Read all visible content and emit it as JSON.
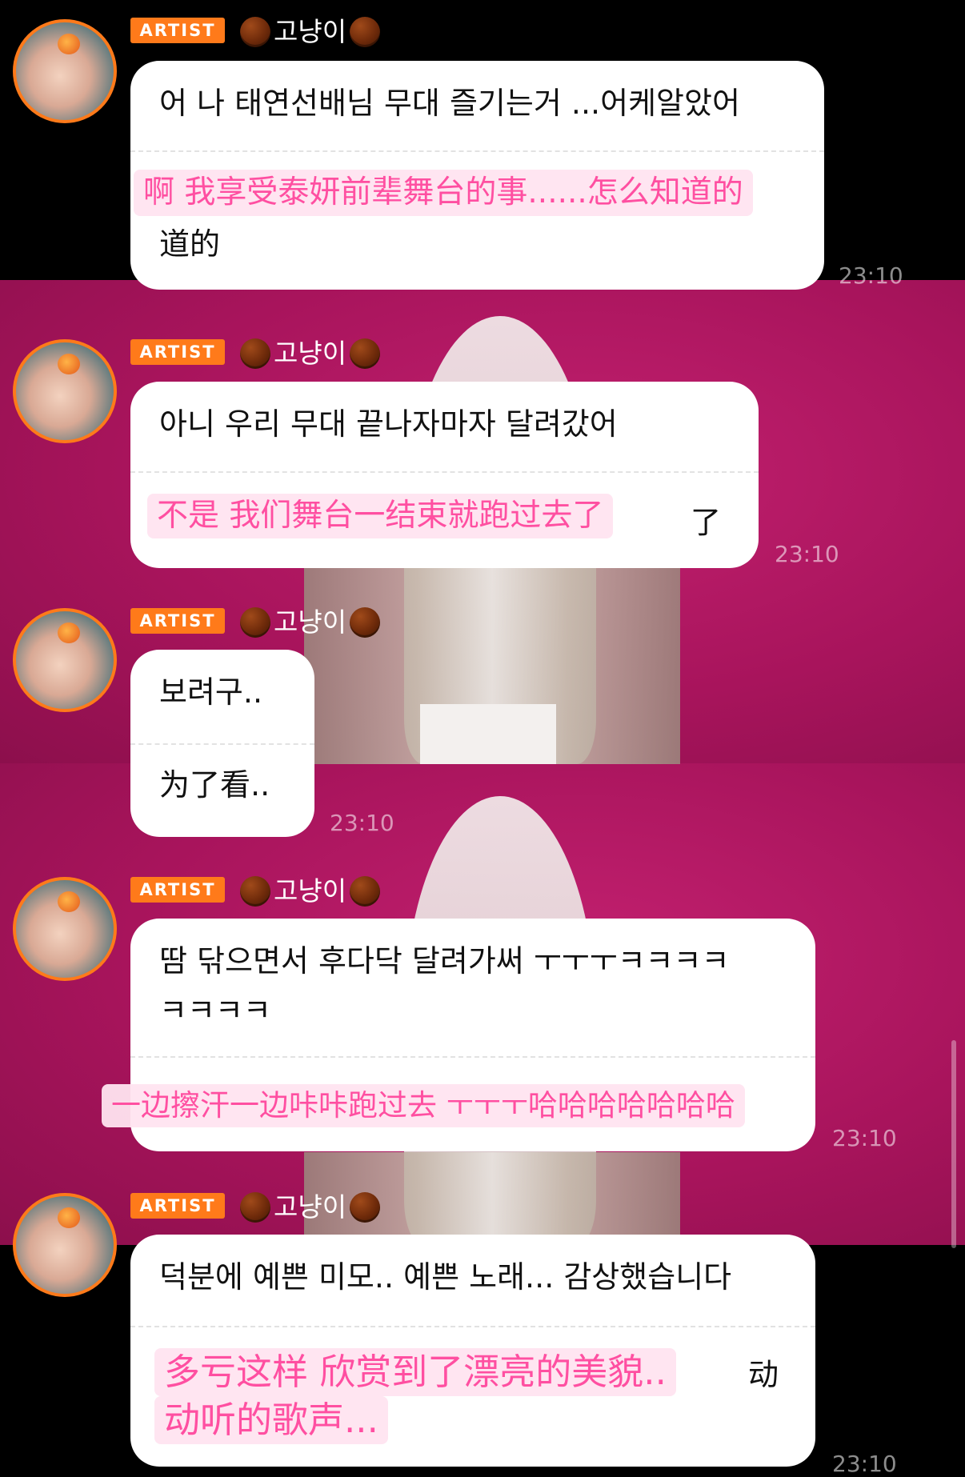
{
  "messages": [
    {
      "badge": "ARTIST",
      "nickname": "고냥이",
      "ko": "어 나 태연선배님 무대 즐기는거 ...어케알았어",
      "zh": "啊 我享受泰妍前辈舞台的事......怎么知道的",
      "zh_overflow": "道的",
      "time": "23:10"
    },
    {
      "badge": "ARTIST",
      "nickname": "고냥이",
      "ko": "아니 우리 무대 끝나자마자 달려갔어",
      "zh": "不是 我们舞台一结束就跑过去了",
      "zh_overflow": "了",
      "time": "23:10"
    },
    {
      "badge": "ARTIST",
      "nickname": "고냥이",
      "ko": "보려구..",
      "zh": "为了看..",
      "time": "23:10"
    },
    {
      "badge": "ARTIST",
      "nickname": "고냥이",
      "ko": "땀 닦으면서 후다닥 달려가써 ㅜㅜㅜㅋㅋㅋㅋ\nㅋㅋㅋㅋ",
      "zh": "一边擦汗一边咔咔跑过去 ㅜㅜㅜ哈哈哈哈哈哈哈",
      "time": "23:10"
    },
    {
      "badge": "ARTIST",
      "nickname": "고냥이",
      "ko": "덕분에 예쁜 미모.. 예쁜 노래... 감상했습니다",
      "zh_line1": "多亏这样 欣赏到了漂亮的美貌..",
      "zh_overflow": "动",
      "zh_line2": "动听的歌声...",
      "time": "23:10"
    }
  ],
  "colors": {
    "badge": "#ff7a1a",
    "background_band": "#a8145c",
    "highlight_text": "#ff4fa1",
    "bubble": "#ffffff"
  },
  "icons": {
    "nickname_decoration": "chestnut-icon",
    "avatar_decoration": "apple-icon"
  }
}
